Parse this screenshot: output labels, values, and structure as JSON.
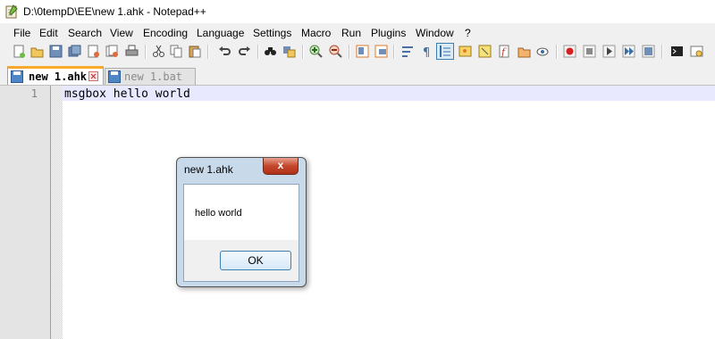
{
  "window": {
    "title": "D:\\0tempD\\EE\\new 1.ahk - Notepad++"
  },
  "menu": [
    "File",
    "Edit",
    "Search",
    "View",
    "Encoding",
    "Language",
    "Settings",
    "Macro",
    "Run",
    "Plugins",
    "Window",
    "?"
  ],
  "tabs": [
    {
      "label": "new 1.ahk",
      "active": true
    },
    {
      "label": "new 1.bat",
      "active": false
    }
  ],
  "editor": {
    "line_number": "1",
    "code": "msgbox hello world"
  },
  "dialog": {
    "title": "new 1.ahk",
    "close_label": "x",
    "message": "hello world",
    "ok_label": "OK"
  }
}
